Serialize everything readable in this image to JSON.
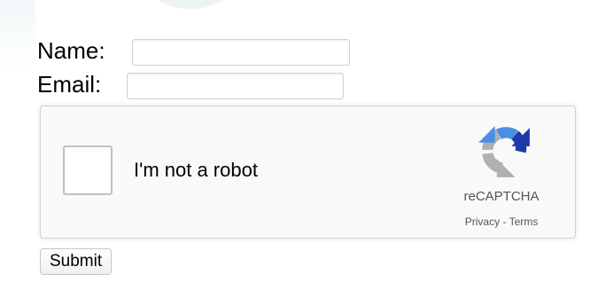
{
  "form": {
    "name_label": "Name:",
    "name_value": "",
    "email_label": "Email:",
    "email_value": "",
    "submit_label": "Submit"
  },
  "recaptcha": {
    "checkbox_checked": false,
    "label": "I'm not a robot",
    "brand": "reCAPTCHA",
    "privacy_link": "Privacy",
    "separator": " - ",
    "terms_link": "Terms",
    "logo_icon": "recaptcha-logo-icon",
    "logo_colors": {
      "blue_dark": "#1c3aa9",
      "blue_light": "#4a90e2",
      "gray": "#b0b0b0"
    }
  },
  "colors": {
    "panel_background": "#f9f9f9",
    "panel_border": "#d3d3d3",
    "checkbox_border": "#c1c1c1",
    "text": "#000000",
    "muted_text": "#555555"
  }
}
